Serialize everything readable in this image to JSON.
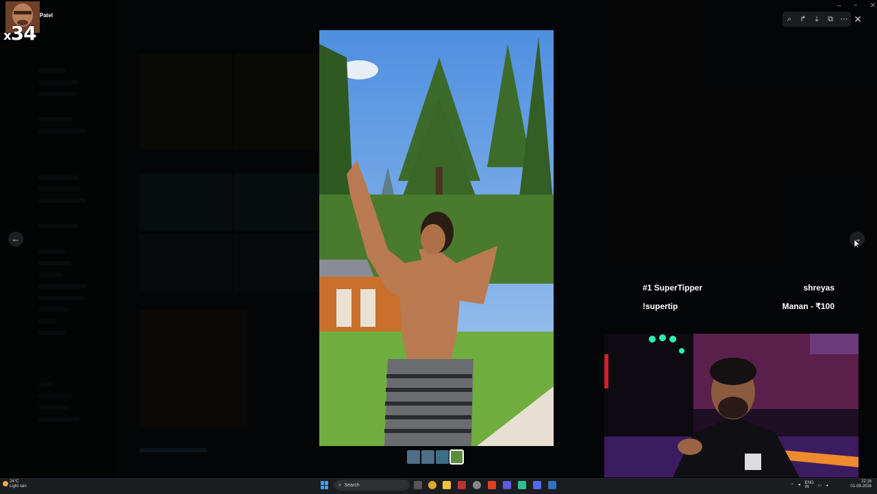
{
  "stream_badge": {
    "name": "Patel",
    "multiplier_prefix": "x",
    "multiplier_value": "34"
  },
  "overlay": {
    "tipper_title": "#1 SuperTipper",
    "tipper_name": "shreyas",
    "tip_command": "!supertip",
    "tip_latest": "Manan - ₹100"
  },
  "viewer": {
    "toolbar_icons": [
      "zoom-icon",
      "forward-icon",
      "download-icon",
      "open-external-icon",
      "more-icon"
    ],
    "close_label": "✕",
    "prev_label": "←",
    "next_label": "→",
    "thumbnail_count": 4,
    "active_thumbnail": 3
  },
  "taskbar": {
    "weather_temp": "24°C",
    "weather_desc": "Light rain",
    "search_placeholder": "Search",
    "lang_line1": "ENG",
    "lang_line2": "IN",
    "time": "22:16",
    "date": "01-08-2026"
  },
  "colors": {
    "accent": "#3ea0f3",
    "background": "#000000",
    "taskbar": "#1c1d20"
  }
}
